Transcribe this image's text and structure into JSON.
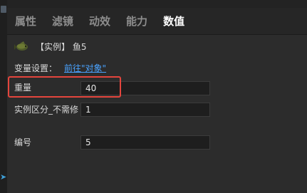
{
  "tabs": [
    {
      "label": "属性",
      "active": false
    },
    {
      "label": "滤镜",
      "active": false
    },
    {
      "label": "动效",
      "active": false
    },
    {
      "label": "能力",
      "active": false
    },
    {
      "label": "数值",
      "active": true
    }
  ],
  "object": {
    "icon": "fish-icon",
    "label": "【实例】 鱼5"
  },
  "variable_settings": {
    "label": "变量设置：",
    "link": "前往\"对象\""
  },
  "fields": [
    {
      "label": "重量",
      "value": "40"
    },
    {
      "label": "实例区分_不需修",
      "value": "1"
    },
    {
      "label": "编号",
      "value": "5"
    }
  ],
  "colors": {
    "accent_link": "#4aa3ff",
    "highlight": "#e4453d"
  }
}
